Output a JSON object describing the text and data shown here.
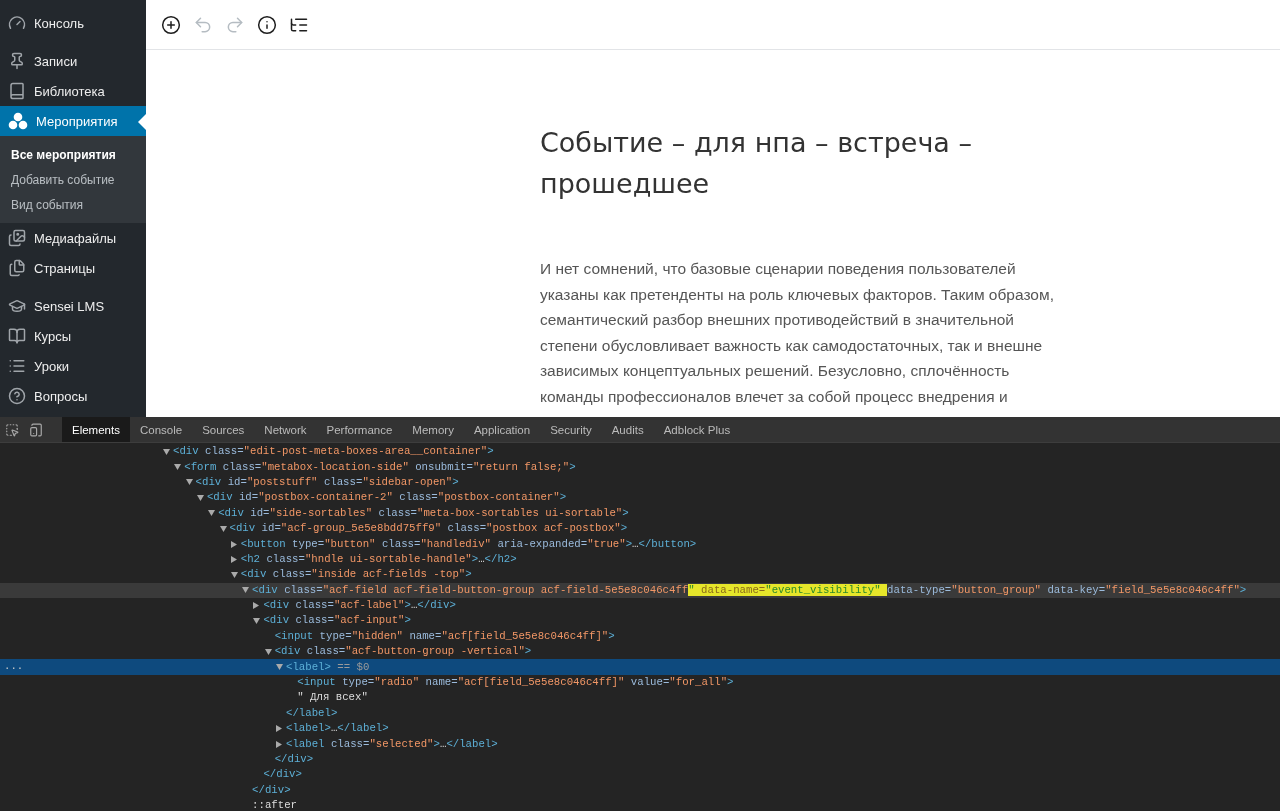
{
  "sidebar": {
    "groups": [
      [
        {
          "label": "Консоль",
          "selected": false
        }
      ],
      [
        {
          "label": "Записи",
          "selected": false
        },
        {
          "label": "Библиотека",
          "selected": false
        },
        {
          "label": "Мероприятия",
          "selected": true,
          "submenu": [
            {
              "label": "Все мероприятия",
              "selected": true
            },
            {
              "label": "Добавить событие",
              "selected": false
            },
            {
              "label": "Вид события",
              "selected": false
            }
          ]
        },
        {
          "label": "Медиафайлы",
          "selected": false
        },
        {
          "label": "Страницы",
          "selected": false
        }
      ],
      [
        {
          "label": "Sensei LMS",
          "selected": false
        },
        {
          "label": "Курсы",
          "selected": false
        },
        {
          "label": "Уроки",
          "selected": false
        },
        {
          "label": "Вопросы",
          "selected": false
        }
      ]
    ]
  },
  "toolbar": [
    {
      "disabled": false
    },
    {
      "disabled": true
    },
    {
      "disabled": true
    },
    {
      "disabled": false
    },
    {
      "disabled": false
    }
  ],
  "editor": {
    "title": "Событие – для нпа – встреча – прошедшее",
    "paragraph": "И нет сомнений, что базовые сценарии поведения пользователей указаны как претенденты на роль ключевых факторов. Таким образом, семантический разбор внешних противодействий в значительной степени обусловливает важность как самодостаточных, так и внешне зависимых концептуальных решений. Безусловно, сплочённость команды профессионалов влечет за собой процесс внедрения и"
  },
  "devtools": {
    "tabs": [
      {
        "label": "Elements",
        "selected": true
      },
      {
        "label": "Console",
        "selected": false
      },
      {
        "label": "Sources",
        "selected": false
      },
      {
        "label": "Network",
        "selected": false
      },
      {
        "label": "Performance",
        "selected": false
      },
      {
        "label": "Memory",
        "selected": false
      },
      {
        "label": "Application",
        "selected": false
      },
      {
        "label": "Security",
        "selected": false
      },
      {
        "label": "Audits",
        "selected": false
      },
      {
        "label": "Adblock Plus",
        "selected": false
      }
    ],
    "dom": [
      {
        "open": [
          {
            "kind": "tag",
            "text": "<div"
          },
          {
            "kind": "attr",
            "text": " class="
          },
          {
            "kind": "value",
            "text": "\"edit-post-meta-boxes-area__container\""
          },
          {
            "kind": "tag",
            "text": ">"
          }
        ],
        "expanded": true,
        "selected": false,
        "hovered": false,
        "children": [
          {
            "open": [
              {
                "kind": "tag",
                "text": "<form"
              },
              {
                "kind": "attr",
                "text": " class="
              },
              {
                "kind": "value",
                "text": "\"metabox-location-side\""
              },
              {
                "kind": "attr",
                "text": " onsubmit="
              },
              {
                "kind": "value",
                "text": "\"return false;\""
              },
              {
                "kind": "tag",
                "text": ">"
              }
            ],
            "expanded": true,
            "selected": false,
            "hovered": false,
            "children": [
              {
                "open": [
                  {
                    "kind": "tag",
                    "text": "<div"
                  },
                  {
                    "kind": "attr",
                    "text": " id="
                  },
                  {
                    "kind": "value",
                    "text": "\"poststuff\""
                  },
                  {
                    "kind": "attr",
                    "text": " class="
                  },
                  {
                    "kind": "value",
                    "text": "\"sidebar-open\""
                  },
                  {
                    "kind": "tag",
                    "text": ">"
                  }
                ],
                "expanded": true,
                "selected": false,
                "hovered": false,
                "children": [
                  {
                    "open": [
                      {
                        "kind": "tag",
                        "text": "<div"
                      },
                      {
                        "kind": "attr",
                        "text": " id="
                      },
                      {
                        "kind": "value",
                        "text": "\"postbox-container-2\""
                      },
                      {
                        "kind": "attr",
                        "text": " class="
                      },
                      {
                        "kind": "value",
                        "text": "\"postbox-container\""
                      },
                      {
                        "kind": "tag",
                        "text": ">"
                      }
                    ],
                    "expanded": true,
                    "selected": false,
                    "hovered": false,
                    "children": [
                      {
                        "open": [
                          {
                            "kind": "tag",
                            "text": "<div"
                          },
                          {
                            "kind": "attr",
                            "text": " id="
                          },
                          {
                            "kind": "value",
                            "text": "\"side-sortables\""
                          },
                          {
                            "kind": "attr",
                            "text": " class="
                          },
                          {
                            "kind": "value",
                            "text": "\"meta-box-sortables ui-sortable\""
                          },
                          {
                            "kind": "tag",
                            "text": ">"
                          }
                        ],
                        "expanded": true,
                        "selected": false,
                        "hovered": false,
                        "children": [
                          {
                            "open": [
                              {
                                "kind": "tag",
                                "text": "<div"
                              },
                              {
                                "kind": "attr",
                                "text": " id="
                              },
                              {
                                "kind": "value",
                                "text": "\"acf-group_5e5e8bdd75ff9\""
                              },
                              {
                                "kind": "attr",
                                "text": " class="
                              },
                              {
                                "kind": "value",
                                "text": "\"postbox acf-postbox\""
                              },
                              {
                                "kind": "tag",
                                "text": ">"
                              }
                            ],
                            "expanded": true,
                            "selected": false,
                            "hovered": false,
                            "children": [
                              {
                                "open": [
                                  {
                                    "kind": "tag",
                                    "text": "<button"
                                  },
                                  {
                                    "kind": "attr",
                                    "text": " type="
                                  },
                                  {
                                    "kind": "value",
                                    "text": "\"button\""
                                  },
                                  {
                                    "kind": "attr",
                                    "text": " class="
                                  },
                                  {
                                    "kind": "value",
                                    "text": "\"handlediv\""
                                  },
                                  {
                                    "kind": "attr",
                                    "text": " aria-expanded="
                                  },
                                  {
                                    "kind": "value",
                                    "text": "\"true\""
                                  },
                                  {
                                    "kind": "tag",
                                    "text": ">"
                                  },
                                  {
                                    "kind": "plain",
                                    "text": "…"
                                  },
                                  {
                                    "kind": "tag",
                                    "text": "</button>"
                                  }
                                ],
                                "expanded": false,
                                "selected": false,
                                "hovered": false
                              },
                              {
                                "open": [
                                  {
                                    "kind": "tag",
                                    "text": "<h2"
                                  },
                                  {
                                    "kind": "attr",
                                    "text": " class="
                                  },
                                  {
                                    "kind": "value",
                                    "text": "\"hndle ui-sortable-handle\""
                                  },
                                  {
                                    "kind": "tag",
                                    "text": ">"
                                  },
                                  {
                                    "kind": "plain",
                                    "text": "…"
                                  },
                                  {
                                    "kind": "tag",
                                    "text": "</h2>"
                                  }
                                ],
                                "expanded": false,
                                "selected": false,
                                "hovered": false
                              },
                              {
                                "open": [
                                  {
                                    "kind": "tag",
                                    "text": "<div"
                                  },
                                  {
                                    "kind": "attr",
                                    "text": " class="
                                  },
                                  {
                                    "kind": "value",
                                    "text": "\"inside acf-fields -top\""
                                  },
                                  {
                                    "kind": "tag",
                                    "text": ">"
                                  }
                                ],
                                "expanded": true,
                                "selected": false,
                                "hovered": false,
                                "children": [
                                  {
                                    "open": [
                                      {
                                        "kind": "tag",
                                        "text": "<div"
                                      },
                                      {
                                        "kind": "attr",
                                        "text": " class="
                                      },
                                      {
                                        "kind": "value",
                                        "text": "\"acf-field acf-field-button-group acf-field-5e5e8c046c4ff"
                                      },
                                      {
                                        "kind": "value",
                                        "text": "\"",
                                        "highlighted": true
                                      },
                                      {
                                        "kind": "attr",
                                        "text": " data-name=",
                                        "highlighted": true
                                      },
                                      {
                                        "kind": "value",
                                        "text": "\"event_visibility\" ",
                                        "highlighted": true
                                      },
                                      {
                                        "kind": "attr",
                                        "text": "data-type="
                                      },
                                      {
                                        "kind": "value",
                                        "text": "\"button_group\""
                                      },
                                      {
                                        "kind": "attr",
                                        "text": " data-key="
                                      },
                                      {
                                        "kind": "value",
                                        "text": "\"field_5e5e8c046c4ff\""
                                      },
                                      {
                                        "kind": "tag",
                                        "text": ">"
                                      }
                                    ],
                                    "expanded": true,
                                    "selected": false,
                                    "hovered": true,
                                    "children": [
                                      {
                                        "open": [
                                          {
                                            "kind": "tag",
                                            "text": "<div"
                                          },
                                          {
                                            "kind": "attr",
                                            "text": " class="
                                          },
                                          {
                                            "kind": "value",
                                            "text": "\"acf-label\""
                                          },
                                          {
                                            "kind": "tag",
                                            "text": ">"
                                          },
                                          {
                                            "kind": "plain",
                                            "text": "…"
                                          },
                                          {
                                            "kind": "tag",
                                            "text": "</div>"
                                          }
                                        ],
                                        "expanded": false,
                                        "selected": false,
                                        "hovered": false
                                      },
                                      {
                                        "open": [
                                          {
                                            "kind": "tag",
                                            "text": "<div"
                                          },
                                          {
                                            "kind": "attr",
                                            "text": " class="
                                          },
                                          {
                                            "kind": "value",
                                            "text": "\"acf-input\""
                                          },
                                          {
                                            "kind": "tag",
                                            "text": ">"
                                          }
                                        ],
                                        "expanded": true,
                                        "selected": false,
                                        "hovered": false,
                                        "children": [
                                          {
                                            "open": [
                                              {
                                                "kind": "tag",
                                                "text": "<input"
                                              },
                                              {
                                                "kind": "attr",
                                                "text": " type="
                                              },
                                              {
                                                "kind": "value",
                                                "text": "\"hidden\""
                                              },
                                              {
                                                "kind": "attr",
                                                "text": " name="
                                              },
                                              {
                                                "kind": "value",
                                                "text": "\"acf[field_5e5e8c046c4ff]\""
                                              },
                                              {
                                                "kind": "tag",
                                                "text": ">"
                                              }
                                            ],
                                            "selected": false,
                                            "hovered": false
                                          },
                                          {
                                            "open": [
                                              {
                                                "kind": "tag",
                                                "text": "<div"
                                              },
                                              {
                                                "kind": "attr",
                                                "text": " class="
                                              },
                                              {
                                                "kind": "value",
                                                "text": "\"acf-button-group -vertical\""
                                              },
                                              {
                                                "kind": "tag",
                                                "text": ">"
                                              }
                                            ],
                                            "expanded": true,
                                            "selected": false,
                                            "hovered": false,
                                            "children": [
                                              {
                                                "open": [
                                                  {
                                                    "kind": "tag",
                                                    "text": "<label>"
                                                  },
                                                  {
                                                    "kind": "dim",
                                                    "text": " == $0"
                                                  }
                                                ],
                                                "gutter": "...",
                                                "expanded": true,
                                                "selected": true,
                                                "hovered": false,
                                                "children": [
                                                  {
                                                    "open": [
                                                      {
                                                        "kind": "tag",
                                                        "text": "<input"
                                                      },
                                                      {
                                                        "kind": "attr",
                                                        "text": " type="
                                                      },
                                                      {
                                                        "kind": "value",
                                                        "text": "\"radio\""
                                                      },
                                                      {
                                                        "kind": "attr",
                                                        "text": " name="
                                                      },
                                                      {
                                                        "kind": "value",
                                                        "text": "\"acf[field_5e5e8c046c4ff]\""
                                                      },
                                                      {
                                                        "kind": "attr",
                                                        "text": " value="
                                                      },
                                                      {
                                                        "kind": "value",
                                                        "text": "\"for_all\""
                                                      },
                                                      {
                                                        "kind": "tag",
                                                        "text": ">"
                                                      }
                                                    ],
                                                    "selected": false,
                                                    "hovered": false
                                                  },
                                                  {
                                                    "open": [
                                                      {
                                                        "kind": "plain",
                                                        "text": "\" Для всех\""
                                                      }
                                                    ],
                                                    "selected": false,
                                                    "hovered": false
                                                  }
                                                ],
                                                "close": [
                                                  {
                                                    "kind": "tag",
                                                    "text": "</label>"
                                                  }
                                                ]
                                              },
                                              {
                                                "open": [
                                                  {
                                                    "kind": "tag",
                                                    "text": "<label>"
                                                  },
                                                  {
                                                    "kind": "plain",
                                                    "text": "…"
                                                  },
                                                  {
                                                    "kind": "tag",
                                                    "text": "</label>"
                                                  }
                                                ],
                                                "expanded": false,
                                                "selected": false,
                                                "hovered": false
                                              },
                                              {
                                                "open": [
                                                  {
                                                    "kind": "tag",
                                                    "text": "<label"
                                                  },
                                                  {
                                                    "kind": "attr",
                                                    "text": " class="
                                                  },
                                                  {
                                                    "kind": "value",
                                                    "text": "\"selected\""
                                                  },
                                                  {
                                                    "kind": "tag",
                                                    "text": ">"
                                                  },
                                                  {
                                                    "kind": "plain",
                                                    "text": "…"
                                                  },
                                                  {
                                                    "kind": "tag",
                                                    "text": "</label>"
                                                  }
                                                ],
                                                "expanded": false,
                                                "selected": false,
                                                "hovered": false
                                              }
                                            ],
                                            "close": [
                                              {
                                                "kind": "tag",
                                                "text": "</div>"
                                              }
                                            ]
                                          }
                                        ],
                                        "close": [
                                          {
                                            "kind": "tag",
                                            "text": "</div>"
                                          }
                                        ]
                                      }
                                    ],
                                    "close": [
                                      {
                                        "kind": "tag",
                                        "text": "</div>"
                                      }
                                    ]
                                  },
                                  {
                                    "open": [
                                      {
                                        "kind": "plain",
                                        "text": "::after"
                                      }
                                    ],
                                    "selected": false,
                                    "hovered": false
                                  }
                                ]
                              }
                            ]
                          }
                        ]
                      }
                    ]
                  }
                ]
              }
            ]
          }
        ]
      }
    ]
  }
}
